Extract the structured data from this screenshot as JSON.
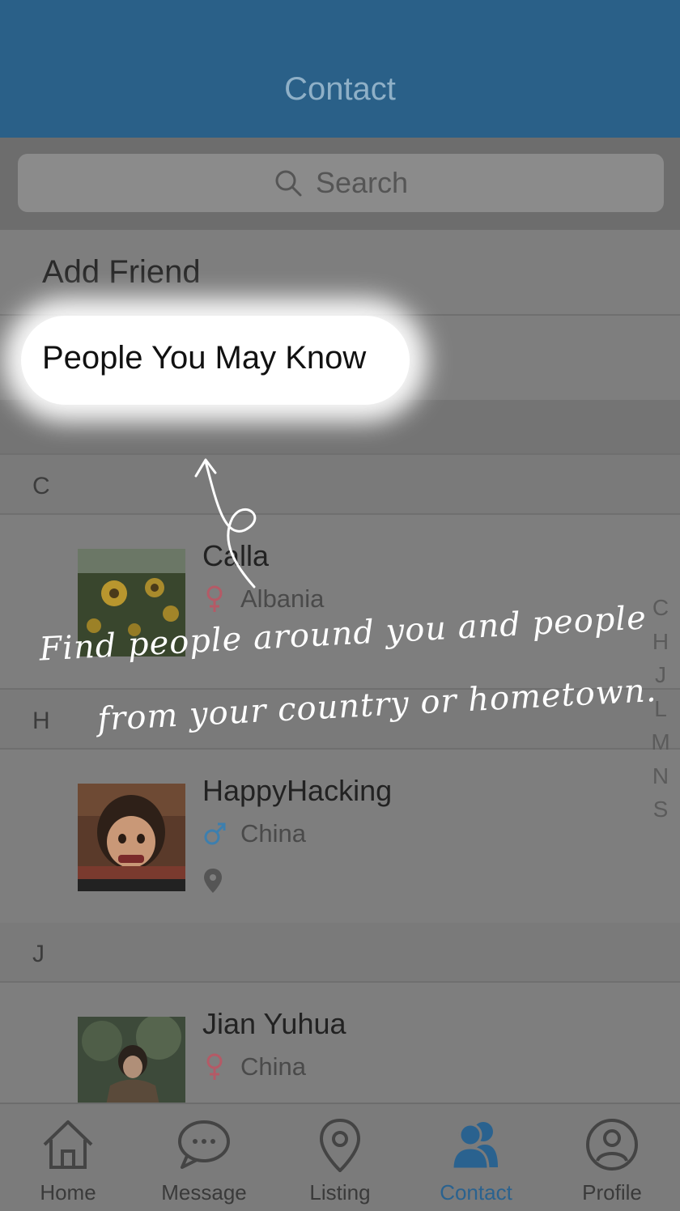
{
  "header": {
    "title": "Contact"
  },
  "search": {
    "placeholder": "Search"
  },
  "menu": {
    "add_friend": "Add Friend",
    "people_you_may_know": "People You May Know"
  },
  "sections": [
    {
      "letter": "C",
      "contacts": [
        {
          "name": "Calla",
          "gender": "female",
          "country": "Albania"
        }
      ]
    },
    {
      "letter": "H",
      "contacts": [
        {
          "name": "HappyHacking",
          "gender": "male",
          "country": "China"
        }
      ]
    },
    {
      "letter": "J",
      "contacts": [
        {
          "name": "Jian Yuhua",
          "gender": "female",
          "country": "China"
        }
      ]
    }
  ],
  "index": [
    "C",
    "H",
    "J",
    "L",
    "M",
    "N",
    "S"
  ],
  "annotation": {
    "line1": "Find people around you and people",
    "line2": "from your country or hometown."
  },
  "tabs": [
    {
      "label": "Home",
      "icon": "home-icon"
    },
    {
      "label": "Message",
      "icon": "chat-bubble-icon"
    },
    {
      "label": "Listing",
      "icon": "map-pin-icon"
    },
    {
      "label": "Contact",
      "icon": "contacts-icon",
      "active": true
    },
    {
      "label": "Profile",
      "icon": "user-circle-icon"
    }
  ],
  "colors": {
    "header": "#2a6088",
    "accent": "#2a628f",
    "female": "#b45a66",
    "male": "#3d7fae"
  }
}
